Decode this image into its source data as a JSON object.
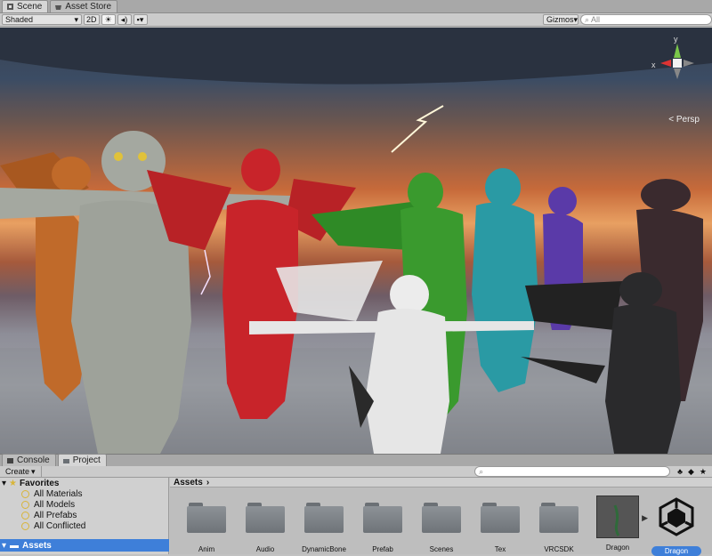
{
  "tabs": [
    {
      "label": "Scene",
      "icon": "scene-icon",
      "active": true
    },
    {
      "label": "Asset Store",
      "icon": "store-icon",
      "active": false
    }
  ],
  "toolbar": {
    "shading_mode": "Shaded",
    "mode_2d": "2D",
    "gizmos_label": "Gizmos",
    "search_placeholder": "All"
  },
  "viewport": {
    "projection_label": "Persp",
    "gizmo_axes": {
      "x": "x",
      "y": "y"
    }
  },
  "bottom_tabs": [
    {
      "label": "Console",
      "icon": "console-icon",
      "active": false
    },
    {
      "label": "Project",
      "icon": "project-icon",
      "active": true
    }
  ],
  "project": {
    "create_label": "Create",
    "favorites": {
      "title": "Favorites",
      "items": [
        "All Materials",
        "All Models",
        "All Prefabs",
        "All Conflicted"
      ]
    },
    "root_label": "Assets",
    "breadcrumb": "Assets",
    "assets": [
      {
        "label": "Anim",
        "kind": "folder"
      },
      {
        "label": "Audio",
        "kind": "folder"
      },
      {
        "label": "DynamicBone",
        "kind": "folder"
      },
      {
        "label": "Prefab",
        "kind": "folder"
      },
      {
        "label": "Scenes",
        "kind": "folder"
      },
      {
        "label": "Tex",
        "kind": "folder"
      },
      {
        "label": "VRCSDK",
        "kind": "folder"
      },
      {
        "label": "Dragon",
        "kind": "model"
      },
      {
        "label": "Dragon",
        "kind": "unity-scene",
        "selected": true
      }
    ]
  },
  "colors": {
    "selection": "#3e7fd9",
    "dragon_colors": [
      "#c06a2a",
      "#a4a8a0",
      "#c8242a",
      "#3a9a2e",
      "#2a9aa4",
      "#5a3aa8",
      "#e6e6e6",
      "#2a2a2c",
      "#3a2a2e"
    ]
  }
}
